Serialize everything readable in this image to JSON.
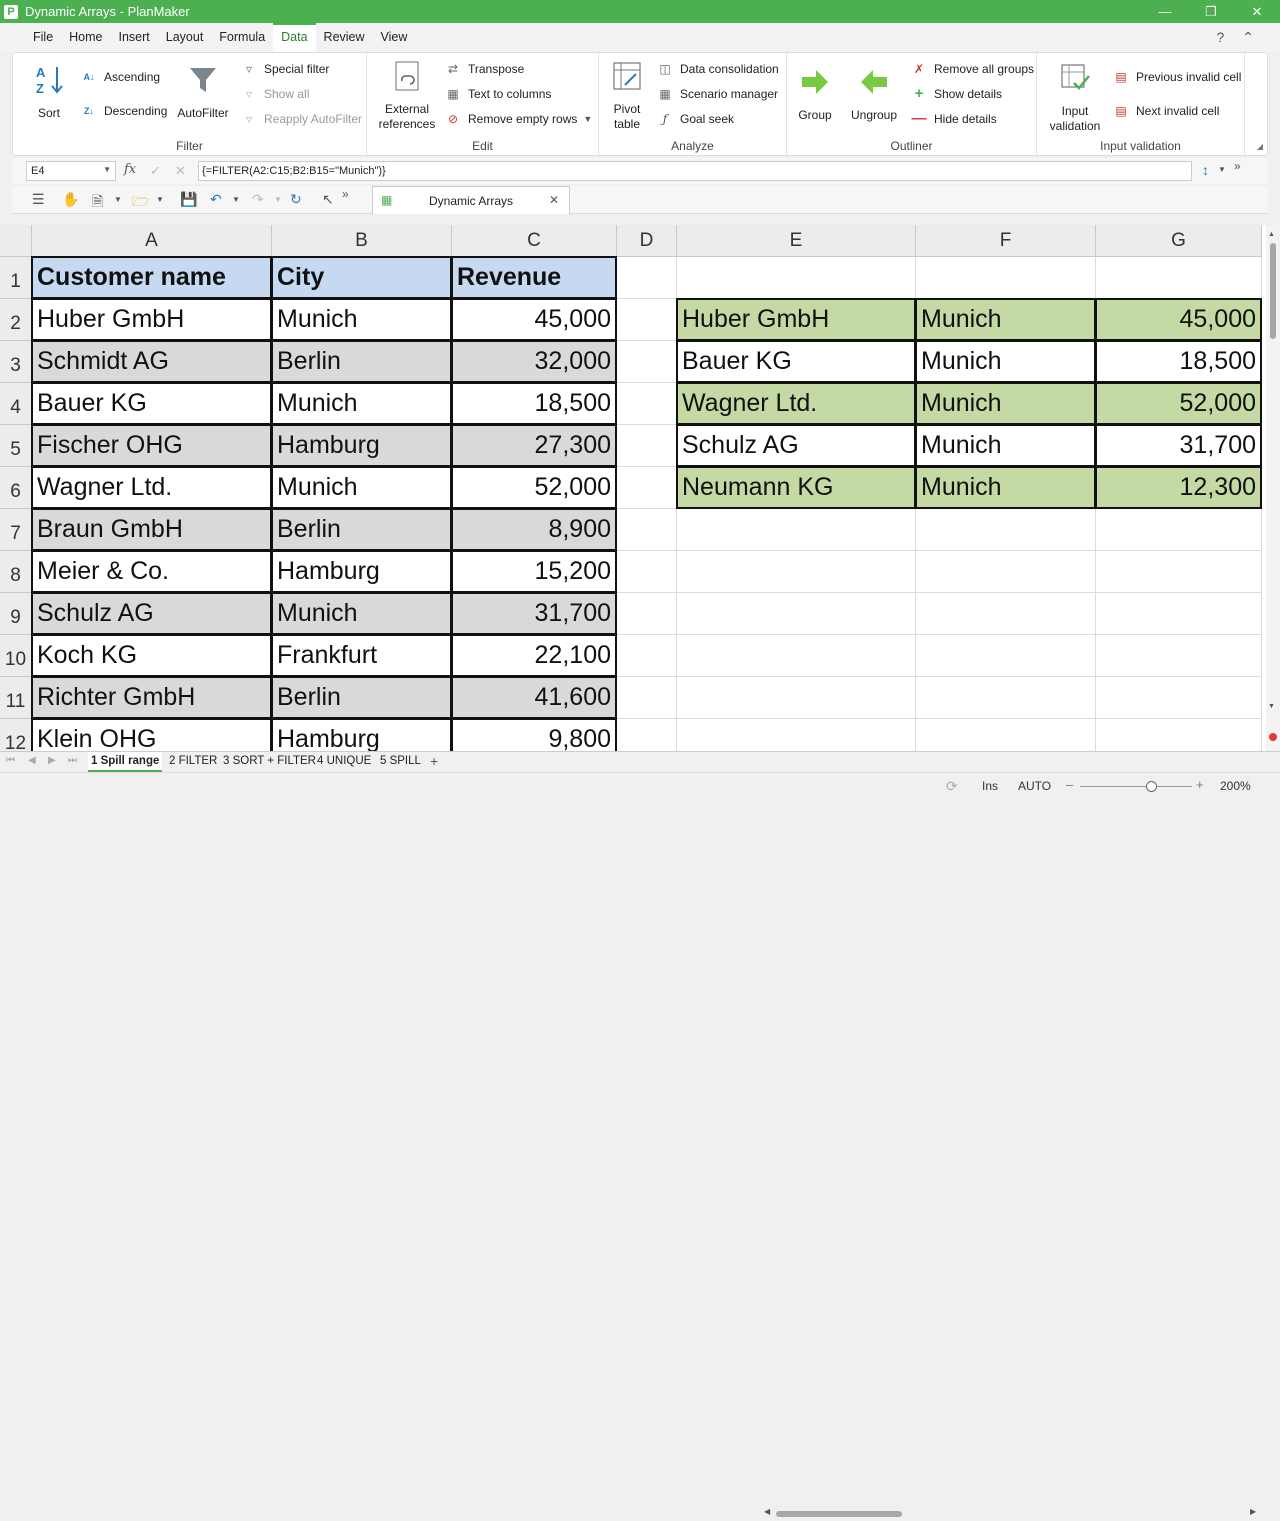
{
  "window": {
    "title": "Dynamic Arrays - PlanMaker",
    "app_icon": "P"
  },
  "menu": {
    "items": [
      "File",
      "Home",
      "Insert",
      "Layout",
      "Formula",
      "Data",
      "Review",
      "View"
    ],
    "active": "Data"
  },
  "ribbon": {
    "filter": {
      "label": "Filter",
      "sort": "Sort",
      "ascending": "Ascending",
      "descending": "Descending",
      "autofilter": "AutoFilter",
      "special_filter": "Special filter",
      "show_all": "Show all",
      "reapply": "Reapply AutoFilter"
    },
    "edit": {
      "label": "Edit",
      "external_line1": "External",
      "external_line2": "references",
      "transpose": "Transpose",
      "text_to_columns": "Text to columns",
      "remove_empty_rows": "Remove empty rows"
    },
    "analyze": {
      "label": "Analyze",
      "pivot_line1": "Pivot",
      "pivot_line2": "table",
      "data_consolidation": "Data consolidation",
      "scenario_manager": "Scenario manager",
      "goal_seek": "Goal seek"
    },
    "outliner": {
      "label": "Outliner",
      "group": "Group",
      "ungroup": "Ungroup",
      "remove_all_groups": "Remove all groups",
      "show_details": "Show details",
      "hide_details": "Hide details"
    },
    "validation": {
      "label": "Input validation",
      "input_line1": "Input",
      "input_line2": "validation",
      "previous_invalid": "Previous invalid cell",
      "next_invalid": "Next invalid cell"
    }
  },
  "formula_bar": {
    "cell_ref": "E4",
    "formula": "{=FILTER(A2:C15;B2:B15=\"Munich\")}"
  },
  "document_tab": {
    "label": "Dynamic Arrays"
  },
  "sheet": {
    "columns": [
      "A",
      "B",
      "C",
      "D",
      "E",
      "F",
      "G"
    ],
    "rows": [
      "1",
      "2",
      "3",
      "4",
      "5",
      "6",
      "7",
      "8",
      "9",
      "10",
      "11",
      "12"
    ],
    "header": [
      "Customer name",
      "City",
      "Revenue"
    ],
    "data": [
      [
        "Huber GmbH",
        "Munich",
        "45,000"
      ],
      [
        "Schmidt AG",
        "Berlin",
        "32,000"
      ],
      [
        "Bauer KG",
        "Munich",
        "18,500"
      ],
      [
        "Fischer OHG",
        "Hamburg",
        "27,300"
      ],
      [
        "Wagner Ltd.",
        "Munich",
        "52,000"
      ],
      [
        "Braun GmbH",
        "Berlin",
        "8,900"
      ],
      [
        "Meier & Co.",
        "Hamburg",
        "15,200"
      ],
      [
        "Schulz AG",
        "Munich",
        "31,700"
      ],
      [
        "Koch KG",
        "Frankfurt",
        "22,100"
      ],
      [
        "Richter GmbH",
        "Berlin",
        "41,600"
      ],
      [
        "Klein OHG",
        "Hamburg",
        "9,800"
      ]
    ],
    "filtered": [
      [
        "Huber GmbH",
        "Munich",
        "45,000"
      ],
      [
        "Bauer KG",
        "Munich",
        "18,500"
      ],
      [
        "Wagner Ltd.",
        "Munich",
        "52,000"
      ],
      [
        "Schulz AG",
        "Munich",
        "31,700"
      ],
      [
        "Neumann KG",
        "Munich",
        "12,300"
      ]
    ],
    "colors": {
      "header_fill": "#c6d9f1",
      "band_fill": "#d9d9d9",
      "filtered_band_fill": "#c5d9a4"
    }
  },
  "sheet_tabs": [
    "1 Spill range",
    "2 FILTER",
    "3 SORT + FILTER",
    "4 UNIQUE",
    "5 SPILL"
  ],
  "active_sheet_tab": "1 Spill range",
  "status": {
    "mode": "Ins",
    "calc": "AUTO",
    "zoom": "200%"
  }
}
